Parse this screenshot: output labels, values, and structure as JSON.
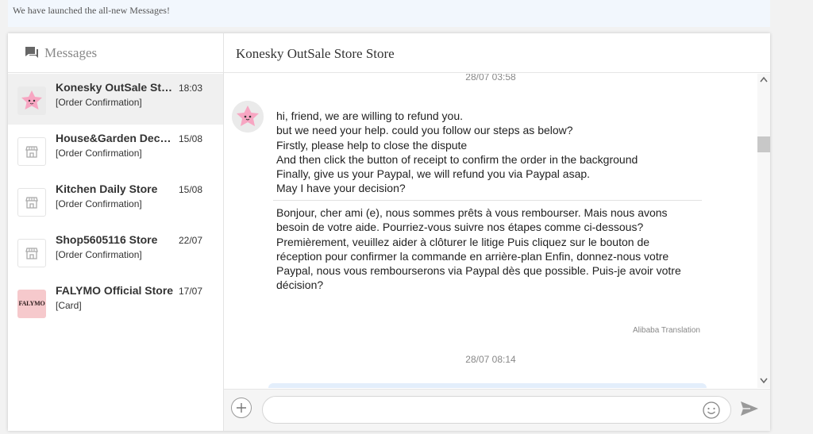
{
  "banner": {
    "text": "We have launched the all-new Messages!"
  },
  "sidebar": {
    "title": "Messages",
    "conversations": [
      {
        "name": "Konesky OutSale Store Store",
        "date": "18:03",
        "preview": "[Order Confirmation]",
        "avatar": "pink-star-icon"
      },
      {
        "name": "House&Garden Decor Store",
        "date": "15/08",
        "preview": "[Order Confirmation]",
        "avatar": "store-icon"
      },
      {
        "name": "Kitchen Daily Store",
        "date": "15/08",
        "preview": "[Order Confirmation]",
        "avatar": "store-icon"
      },
      {
        "name": "Shop5605116 Store",
        "date": "22/07",
        "preview": "[Order Confirmation]",
        "avatar": "store-icon"
      },
      {
        "name": "FALYMO Official Store",
        "date": "17/07",
        "preview": "[Card]",
        "avatar": "falymo-logo",
        "logo_text": "FALYMO"
      }
    ]
  },
  "chat": {
    "title": "Konesky OutSale Store Store",
    "timestamp_top": "28/07 03:58",
    "message_lines": [
      "hi, friend, we are willing to refund you.",
      "but we need your help. could you follow our steps as below?",
      "Firstly, please help to close the dispute",
      "And then click the button of receipt to confirm the order in the background",
      "Finally, give us your Paypal, we will refund you via Paypal asap.",
      "May I have your decision?"
    ],
    "translation_lines": [
      "Bonjour, cher ami (e), nous sommes prêts à vous rembourser.",
      "Mais nous avons besoin de votre aide. Pourriez-vous suivre nos étapes comme ci-dessous?",
      "Premièrement, veuillez aider à clôturer le litige",
      "Puis cliquez sur le bouton de réception pour confirmer la commande en arrière-plan",
      "Enfin, donnez-nous votre Paypal, nous vous rembourserons via Paypal dès que possible.",
      "Puis-je avoir votre décision?"
    ],
    "translation_note": "Alibaba Translation",
    "timestamp_2": "28/07 08:14"
  },
  "composer": {
    "placeholder": "",
    "icons": {
      "add": "plus-icon",
      "emoji": "smiley-icon",
      "send": "send-icon"
    }
  },
  "colors": {
    "banner_bg": "#f2f7fd",
    "active_row": "#f0f0f0",
    "avatar_pink": "#f6c9cc",
    "bubble": "#e3eefb"
  }
}
